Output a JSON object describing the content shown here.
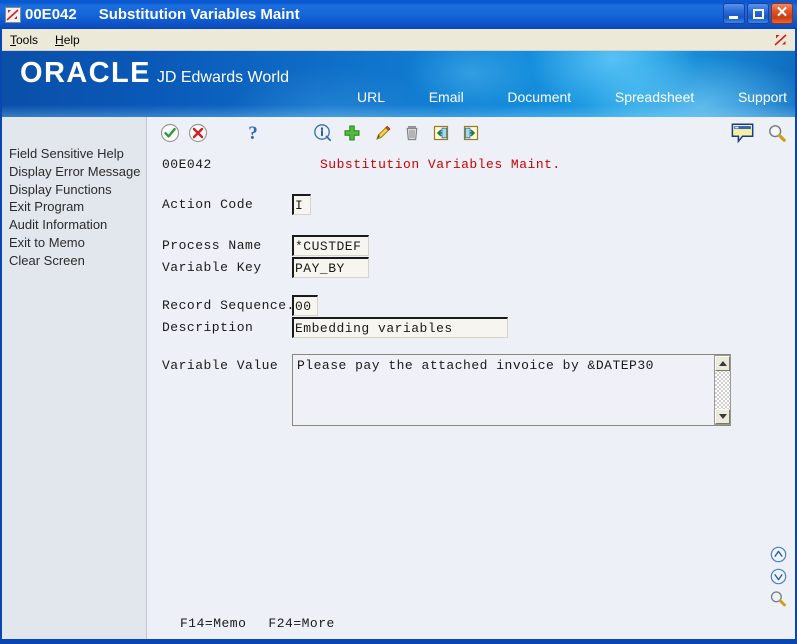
{
  "window": {
    "program_id": "00E042",
    "title": "Substitution Variables Maint",
    "app_icon": "jde-app-icon",
    "buttons": {
      "minimize": "minimize-button",
      "maximize": "maximize-button",
      "close": "close-button"
    }
  },
  "menubar": {
    "items": [
      {
        "label": "Tools",
        "accel": "T"
      },
      {
        "label": "Help",
        "accel": "H"
      }
    ],
    "right_icon": "jde-logo-icon"
  },
  "banner": {
    "brand": "ORACLE",
    "product": "JD Edwards World",
    "nav": [
      {
        "label": "URL"
      },
      {
        "label": "Email"
      },
      {
        "label": "Document"
      },
      {
        "label": "Spreadsheet"
      },
      {
        "label": "Support"
      }
    ]
  },
  "sidebar": {
    "items": [
      {
        "label": "Field Sensitive Help"
      },
      {
        "label": "Display Error Message"
      },
      {
        "label": "Display Functions"
      },
      {
        "label": "Exit Program"
      },
      {
        "label": "Audit Information"
      },
      {
        "label": "Exit to Memo"
      },
      {
        "label": "Clear Screen"
      }
    ]
  },
  "toolbar": {
    "icons": [
      {
        "name": "accept-check-icon",
        "title": "OK"
      },
      {
        "name": "cancel-x-icon",
        "title": "Cancel"
      },
      {
        "name": "help-question-icon",
        "title": "Help"
      },
      {
        "name": "info-icon",
        "title": "Information"
      },
      {
        "name": "add-plus-icon",
        "title": "Add"
      },
      {
        "name": "edit-pencil-icon",
        "title": "Change"
      },
      {
        "name": "delete-trash-icon",
        "title": "Delete"
      },
      {
        "name": "previous-record-icon",
        "title": "Previous"
      },
      {
        "name": "next-record-icon",
        "title": "Next"
      },
      {
        "name": "memo-note-icon",
        "title": "Memo"
      },
      {
        "name": "search-magnifier-icon",
        "title": "Search"
      }
    ]
  },
  "form": {
    "program_id": "00E042",
    "screen_title": "Substitution Variables Maint.",
    "fields": [
      {
        "label": "Action Code",
        "value": "I"
      },
      {
        "label": "Process Name",
        "value": "*CUSTDEF"
      },
      {
        "label": "Variable Key",
        "value": "PAY_BY"
      },
      {
        "label": "Record Sequence.",
        "value": "00"
      },
      {
        "label": "Description",
        "value": "Embedding variables"
      },
      {
        "label": "Variable Value",
        "value": "Please pay the attached invoice by &DATEP30"
      }
    ],
    "function_keys": [
      {
        "label": "F14=Memo"
      },
      {
        "label": "F24=More"
      }
    ]
  },
  "rightnav": {
    "items": [
      {
        "name": "page-up-icon"
      },
      {
        "name": "page-down-icon"
      },
      {
        "name": "search-magnifier-icon"
      }
    ]
  },
  "colors": {
    "title_blue": "#0b5ad4",
    "banner_blue": "#0e6dc6",
    "screen_title_red": "#cc0000",
    "form_bg": "#eef0f8",
    "sidebar_bg": "#e2e7ee",
    "field_bg": "#f7f5ef"
  }
}
